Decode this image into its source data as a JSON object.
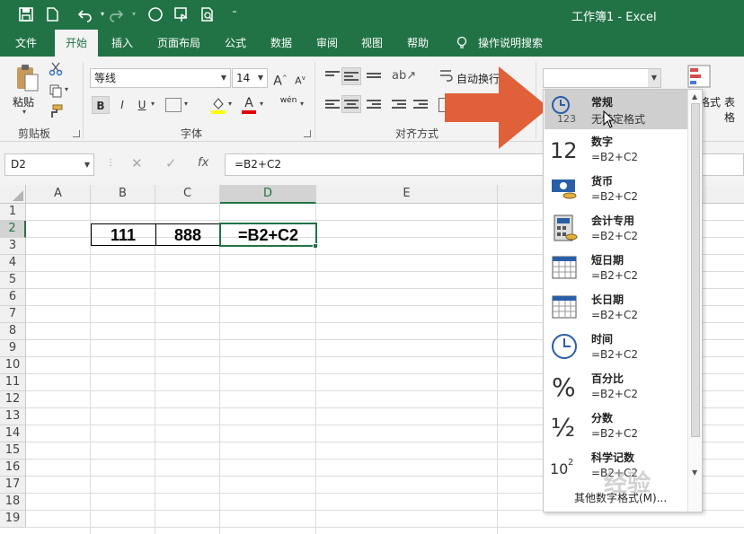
{
  "title_bar": {
    "title": "工作簿1 - Excel",
    "save_icon": "save-icon",
    "new_icon": "new-file-icon",
    "undo_icon": "undo-icon",
    "redo_icon": "redo-icon",
    "shape_icon": "circle-icon",
    "touch_icon": "touch-mode-icon",
    "preview_icon": "print-preview-icon",
    "customize_icon": "customize-qat-icon"
  },
  "menu_tabs": [
    "文件",
    "开始",
    "插入",
    "页面布局",
    "公式",
    "数据",
    "审阅",
    "视图",
    "帮助",
    "操作说明搜索"
  ],
  "active_tab": "开始",
  "ribbon": {
    "clipboard": {
      "paste_label": "粘贴",
      "group_label": "剪贴板"
    },
    "font": {
      "font_name": "等线",
      "font_size": "14",
      "group_label": "字体",
      "bold": "B",
      "italic": "I",
      "underline": "U",
      "grow": "A",
      "shrink": "A",
      "color_letter": "A",
      "phonetic": "wén"
    },
    "alignment": {
      "wrap_label": "自动换行",
      "group_label": "对齐方式"
    },
    "number": {
      "format_value": ""
    },
    "styles": {
      "cond_label": "格式",
      "table_label": "表格"
    }
  },
  "formula_bar": {
    "name_box": "D2",
    "fx_label": "fx",
    "formula": "=B2+C2"
  },
  "columns": [
    "A",
    "B",
    "C",
    "D",
    "E"
  ],
  "rows": [
    "1",
    "2",
    "3",
    "4",
    "5",
    "6",
    "7",
    "8",
    "9",
    "10",
    "11",
    "12",
    "13",
    "14",
    "15",
    "16",
    "17",
    "18",
    "19"
  ],
  "cells": {
    "B2": "111",
    "C2": "888",
    "D2": "=B2+C2"
  },
  "dropdown": {
    "items": [
      {
        "name": "常规",
        "preview": "无特定格式",
        "icon": "clock-123-icon"
      },
      {
        "name": "数字",
        "preview": "=B2+C2",
        "icon": "number-12-icon"
      },
      {
        "name": "货币",
        "preview": "=B2+C2",
        "icon": "currency-icon"
      },
      {
        "name": "会计专用",
        "preview": "=B2+C2",
        "icon": "calculator-icon"
      },
      {
        "name": "短日期",
        "preview": "=B2+C2",
        "icon": "calendar-short-icon"
      },
      {
        "name": "长日期",
        "preview": "=B2+C2",
        "icon": "calendar-long-icon"
      },
      {
        "name": "时间",
        "preview": "=B2+C2",
        "icon": "clock-icon"
      },
      {
        "name": "百分比",
        "preview": "=B2+C2",
        "icon": "percent-icon"
      },
      {
        "name": "分数",
        "preview": "=B2+C2",
        "icon": "fraction-icon"
      },
      {
        "name": "科学记数",
        "preview": "=B2+C2",
        "icon": "scientific-icon"
      }
    ],
    "more_label": "其他数字格式(M)...",
    "highlight_index": 0
  },
  "annotation": {
    "arrow_color": "#e0603a",
    "watermark": "经验"
  },
  "colors": {
    "accent": "#217346",
    "selection": "#217346"
  }
}
